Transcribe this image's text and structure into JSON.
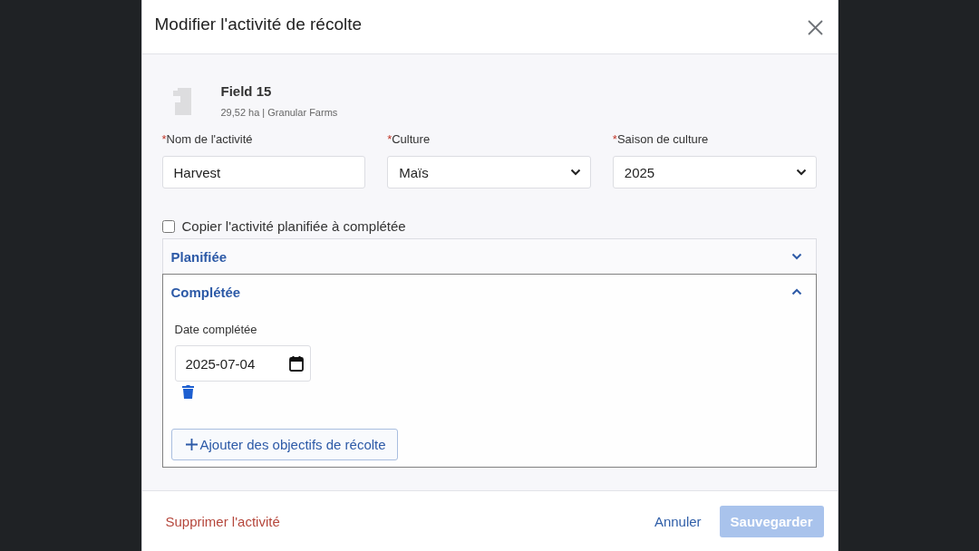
{
  "dialog": {
    "title": "Modifier l'activité de récolte"
  },
  "field": {
    "name": "Field 15",
    "details": "29,52 ha | Granular Farms"
  },
  "form_fields": [
    {
      "kind": "text",
      "required_mark": "*",
      "label": "Nom de l'activité",
      "value": "Harvest"
    },
    {
      "kind": "select",
      "required_mark": "*",
      "label": "Culture",
      "value": "Maïs"
    },
    {
      "kind": "select",
      "required_mark": "*",
      "label": "Saison de culture",
      "value": "2025"
    }
  ],
  "copy_checkbox": {
    "label": "Copier l'activité planifiée à complétée",
    "checked": false
  },
  "sections": [
    {
      "title": "Planifiée",
      "expanded": false
    },
    {
      "title": "Complétée",
      "expanded": true,
      "date_label": "Date complétée",
      "date_value": "2025-07-04",
      "add_button": "Ajouter des objectifs de récolte"
    }
  ],
  "footer": {
    "delete_link": "Supprimer l'activité",
    "cancel_button": "Annuler",
    "save_button": {
      "label": "Sauvegarder",
      "disabled": true
    }
  }
}
